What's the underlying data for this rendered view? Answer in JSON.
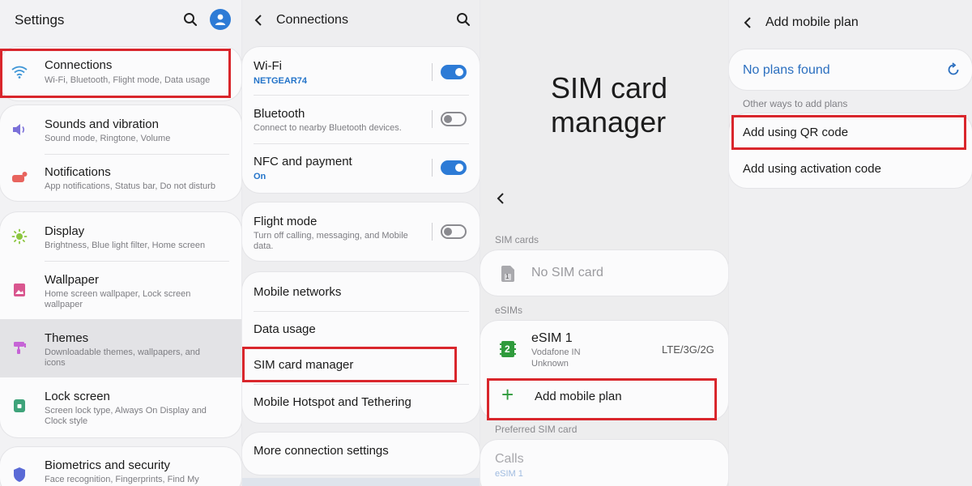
{
  "colors": {
    "accent": "#2d7bd6",
    "highlight_red": "#d9262c",
    "esim_green": "#2f9b3c"
  },
  "settings": {
    "header_title": "Settings",
    "items": [
      {
        "label": "Connections",
        "sub": "Wi-Fi, Bluetooth, Flight mode, Data usage",
        "icon": "wifi-icon"
      },
      {
        "label": "Sounds and vibration",
        "sub": "Sound mode, Ringtone, Volume",
        "icon": "speaker-icon"
      },
      {
        "label": "Notifications",
        "sub": "App notifications, Status bar, Do not disturb",
        "icon": "notification-icon"
      },
      {
        "label": "Display",
        "sub": "Brightness, Blue light filter, Home screen",
        "icon": "brightness-icon"
      },
      {
        "label": "Wallpaper",
        "sub1": "Home screen wallpaper, Lock screen",
        "sub2": "wallpaper",
        "icon": "wallpaper-icon"
      },
      {
        "label": "Themes",
        "sub1": "Downloadable themes, wallpapers, and",
        "sub2": "icons",
        "icon": "themes-icon"
      },
      {
        "label": "Lock screen",
        "sub1": "Screen lock type, Always On Display and",
        "sub2": "Clock style",
        "icon": "lock-icon"
      },
      {
        "label": "Biometrics and security",
        "sub": "Face recognition, Fingerprints, Find My",
        "icon": "shield-icon"
      }
    ]
  },
  "connections": {
    "header_title": "Connections",
    "wifi": {
      "label": "Wi-Fi",
      "sub": "NETGEAR74",
      "on": true
    },
    "bluetooth": {
      "label": "Bluetooth",
      "sub": "Connect to nearby Bluetooth devices.",
      "on": false
    },
    "nfc": {
      "label": "NFC and payment",
      "sub": "On",
      "on": true
    },
    "flight": {
      "label": "Flight mode",
      "sub1": "Turn off calling, messaging, and Mobile",
      "sub2": "data.",
      "on": false
    },
    "mobile_networks": "Mobile networks",
    "data_usage": "Data usage",
    "sim_card_manager": "SIM card manager",
    "hotspot": "Mobile Hotspot and Tethering",
    "more": "More connection settings"
  },
  "sim_manager": {
    "title_line1": "SIM card",
    "title_line2": "manager",
    "sim_cards_header": "SIM cards",
    "no_sim": "No SIM card",
    "sim_badge": "1",
    "esims_header": "eSIMs",
    "esim_name": "eSIM 1",
    "esim_badge": "2",
    "esim_carrier": "Vodafone IN",
    "esim_status": "Unknown",
    "esim_network": "LTE/3G/2G",
    "add_plan": "Add mobile plan",
    "preferred_header": "Preferred SIM card",
    "calls_label": "Calls",
    "calls_value": "eSIM 1"
  },
  "add_plan": {
    "header_title": "Add mobile plan",
    "no_plans": "No plans found",
    "other_ways": "Other ways to add plans",
    "qr": "Add using QR code",
    "activation": "Add using activation code"
  }
}
